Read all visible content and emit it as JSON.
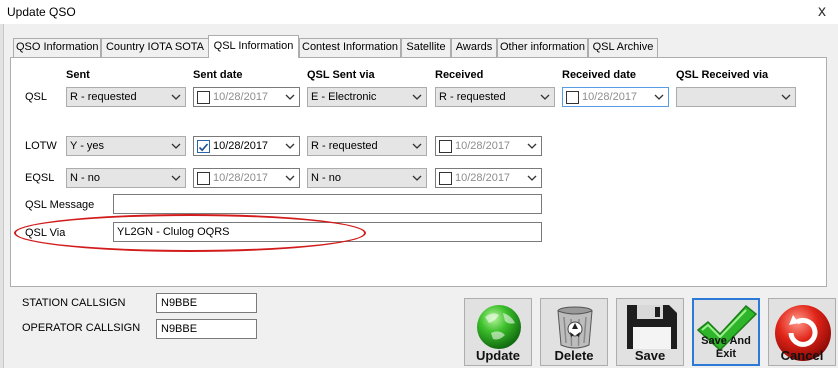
{
  "window": {
    "title": "Update QSO",
    "close": "x"
  },
  "tabs": [
    {
      "label": "QSO Information"
    },
    {
      "label": "Country IOTA SOTA"
    },
    {
      "label": "QSL Information"
    },
    {
      "label": "Contest Information"
    },
    {
      "label": "Satellite"
    },
    {
      "label": "Awards"
    },
    {
      "label": "Other information"
    },
    {
      "label": "QSL Archive"
    }
  ],
  "headers": {
    "sent": "Sent",
    "sent_date": "Sent date",
    "sent_via": "QSL Sent via",
    "received": "Received",
    "received_date": "Received date",
    "received_via": "QSL Received via"
  },
  "qsl": {
    "label": "QSL",
    "sent": "R - requested",
    "sent_date": "10/28/2017",
    "sent_via": "E - Electronic",
    "received": "R - requested",
    "received_date": "10/28/2017",
    "received_via": ""
  },
  "lotw": {
    "label": "LOTW",
    "sent": "Y - yes",
    "sent_date": "10/28/2017",
    "received": "R - requested",
    "received_date": "10/28/2017"
  },
  "eqsl": {
    "label": "EQSL",
    "sent": "N - no",
    "sent_date": "10/28/2017",
    "received": "N - no",
    "received_date": "10/28/2017"
  },
  "qsl_message": {
    "label": "QSL Message",
    "value": ""
  },
  "qsl_via": {
    "label": "QSL Via",
    "value": "YL2GN - Clulog OQRS"
  },
  "station": {
    "label": "STATION CALLSIGN",
    "value": "N9BBE"
  },
  "operator": {
    "label": "OPERATOR CALLSIGN",
    "value": "N9BBE"
  },
  "buttons": {
    "update": "Update",
    "delete": "Delete",
    "save": "Save",
    "save_exit": "Save And Exit",
    "cancel": "Cancel"
  },
  "icons": {
    "update": "globe-icon",
    "delete": "trash-icon",
    "save": "floppy-icon",
    "save_exit": "checkmark-icon",
    "cancel": "cancel-icon"
  }
}
